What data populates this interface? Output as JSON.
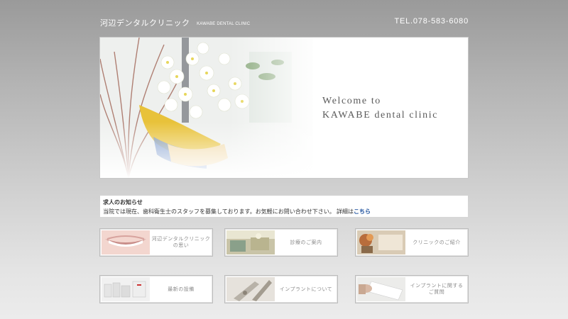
{
  "header": {
    "title": "河辺デンタルクリニック",
    "subtitle": "KAWABE DENTAL CLINIC",
    "tel": "TEL.078-583-6080"
  },
  "hero": {
    "line1": "Welcome to",
    "line2": "KAWABE dental clinic"
  },
  "notice": {
    "title": "求人のお知らせ",
    "body": "当院では現在、歯科衛生士のスタッフを募集しております。お気軽にお問い合わせ下さい。  詳細は",
    "link": "こちら"
  },
  "tiles": [
    {
      "label": "河辺デンタルクリニックの思い"
    },
    {
      "label": "診療のご案内"
    },
    {
      "label": "クリニックのご紹介"
    },
    {
      "label": "最新の設備"
    },
    {
      "label": "インプラントについて"
    },
    {
      "label": "インプラントに関する\nご質問"
    }
  ]
}
